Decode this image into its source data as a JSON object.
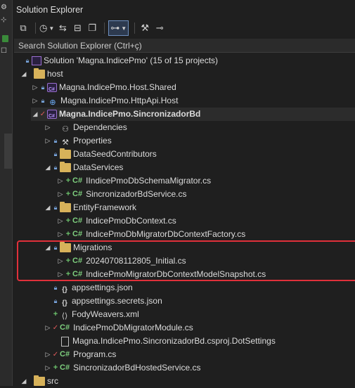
{
  "titlebar": {
    "title": "Solution Explorer"
  },
  "toolbar": {
    "buttons": [
      {
        "name": "vs-project-icon",
        "glyph": "⧉"
      },
      {
        "name": "history-icon",
        "glyph": "◷"
      },
      {
        "name": "sync-icon",
        "glyph": "⇆"
      },
      {
        "name": "collapse-all-icon",
        "glyph": "⊟"
      },
      {
        "name": "copy-icon",
        "glyph": "⧉"
      },
      {
        "name": "show-all-files-icon",
        "glyph": "⊞"
      },
      {
        "name": "wrench-icon",
        "glyph": "🔧"
      },
      {
        "name": "preview-icon",
        "glyph": "⊶"
      }
    ]
  },
  "search": {
    "placeholder": "Search Solution Explorer (Ctrl+ç)"
  },
  "tree": [
    {
      "label": "Solution 'Magna.IndicePmo' (15 of 15 projects)",
      "icon": "solution-icon"
    },
    {
      "label": "host",
      "icon": "folder-icon"
    },
    {
      "label": "Magna.IndicePmo.Host.Shared",
      "icon": "csproj-icon"
    },
    {
      "label": "Magna.IndicePmo.HttpApi.Host",
      "icon": "web-project-icon"
    },
    {
      "label": "Magna.IndicePmo.SincronizadorBd",
      "icon": "csproj-icon"
    },
    {
      "label": "Dependencies",
      "icon": "dependencies-icon"
    },
    {
      "label": "Properties",
      "icon": "properties-icon"
    },
    {
      "label": "DataSeedContributors",
      "icon": "folder-icon"
    },
    {
      "label": "DataServices",
      "icon": "folder-icon"
    },
    {
      "label": "IIndicePmoDbSchemaMigrator.cs",
      "icon": "csharp-file-icon"
    },
    {
      "label": "SincronizadorBdService.cs",
      "icon": "csharp-file-icon"
    },
    {
      "label": "EntityFramework",
      "icon": "folder-icon"
    },
    {
      "label": "IndicePmoDbContext.cs",
      "icon": "csharp-file-icon"
    },
    {
      "label": "IndicePmoDbMigratorDbContextFactory.cs",
      "icon": "csharp-file-icon"
    },
    {
      "label": "Migrations",
      "icon": "folder-icon"
    },
    {
      "label": "20240708112805_Initial.cs",
      "icon": "csharp-file-icon"
    },
    {
      "label": "IndicePmoMigratorDbContextModelSnapshot.cs",
      "icon": "csharp-file-icon"
    },
    {
      "label": "appsettings.json",
      "icon": "json-file-icon"
    },
    {
      "label": "appsettings.secrets.json",
      "icon": "json-file-icon"
    },
    {
      "label": "FodyWeavers.xml",
      "icon": "xml-file-icon"
    },
    {
      "label": "IndicePmoDbMigratorModule.cs",
      "icon": "csharp-file-icon"
    },
    {
      "label": "Magna.IndicePmo.SincronizadorBd.csproj.DotSettings",
      "icon": "file-icon"
    },
    {
      "label": "Program.cs",
      "icon": "csharp-file-icon"
    },
    {
      "label": "SincronizadorBdHostedService.cs",
      "icon": "csharp-file-icon"
    },
    {
      "label": "src",
      "icon": "folder-icon"
    }
  ],
  "colors": {
    "highlight": "#e0303a",
    "folder": "#d7b25a",
    "csharp": "#7fd17f",
    "lock": "#7aa7e0"
  }
}
